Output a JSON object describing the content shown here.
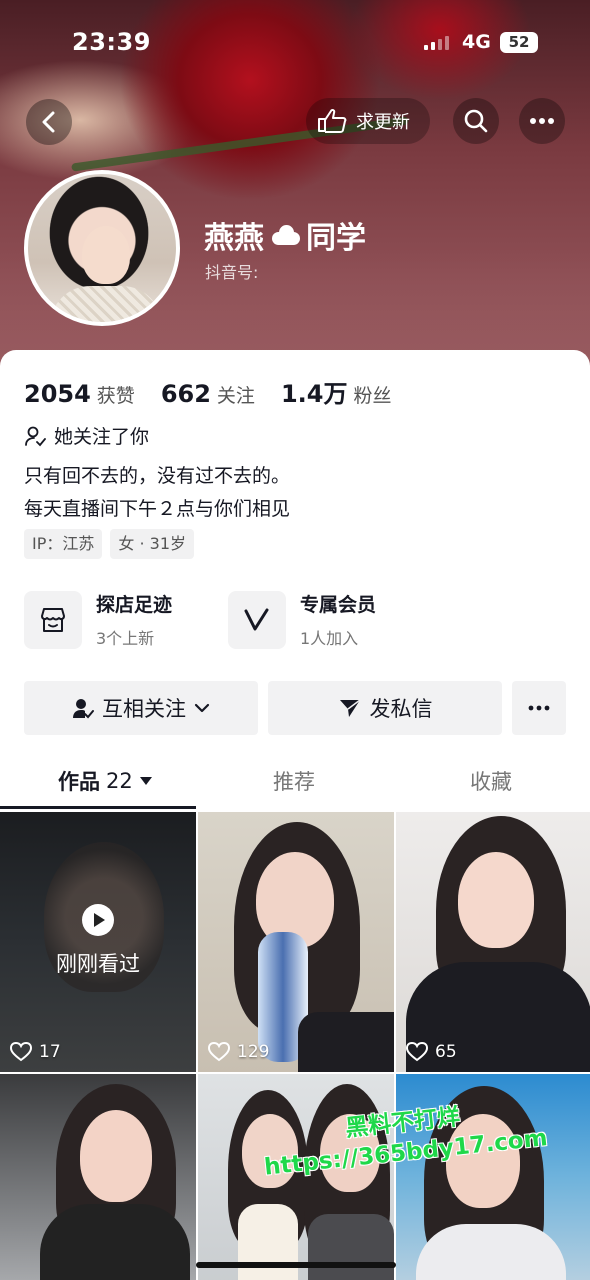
{
  "status_bar": {
    "time": "23:39",
    "network": "4G",
    "battery": "52"
  },
  "header": {
    "back_icon": "chevron-left-icon",
    "request_update_label": "求更新",
    "search_icon": "search-icon",
    "more_icon": "more-dots-icon"
  },
  "profile": {
    "nickname_part1": "燕燕",
    "nickname_part2": "同学",
    "douyin_id_label": "抖音号:",
    "stats": [
      {
        "num": "2054",
        "label": "获赞"
      },
      {
        "num": "662",
        "label": "关注"
      },
      {
        "num": "1.4万",
        "label": "粉丝"
      }
    ],
    "follows_you": "她关注了你",
    "bio_line1": "只有回不去的，没有过不去的。",
    "bio_line2": "每天直播间下午２点与你们相见",
    "tags": [
      "IP：江苏",
      "女 · 31岁"
    ]
  },
  "features": [
    {
      "title": "探店足迹",
      "sub": "3个上新",
      "icon": "store-icon"
    },
    {
      "title": "专属会员",
      "sub": "1人加入",
      "icon": "v-member-icon"
    }
  ],
  "actions": {
    "mutual_follow": "互相关注",
    "message": "发私信"
  },
  "tabs": {
    "works_label": "作品",
    "works_count": "22",
    "recommend": "推荐",
    "collection": "收藏"
  },
  "grid": {
    "recently_watched": "刚刚看过",
    "likes": [
      "17",
      "129",
      "65"
    ]
  },
  "watermark": {
    "line1": "黑料不打烊",
    "line2": "https://365bdy17.com"
  },
  "colors": {
    "text": "#161823",
    "secondary": "#777777",
    "button_bg": "#f2f2f3",
    "watermark": "#1fd84a"
  }
}
